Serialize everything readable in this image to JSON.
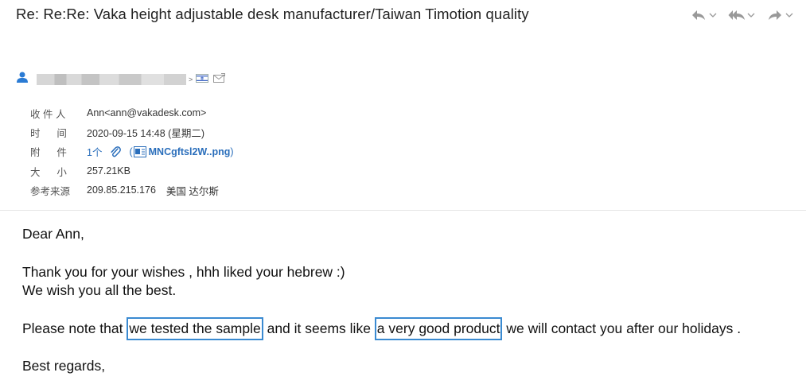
{
  "email": {
    "subject": "Re: Re:Re: Vaka height adjustable desk manufacturer/Taiwan Timotion quality",
    "sender_caret": ">",
    "meta": {
      "recipient_label": "收 件 人",
      "recipient_value": "Ann<ann@vakadesk.com>",
      "time_label": "时      间",
      "time_value": "2020-09-15 14:48 (星期二)",
      "attachment_label": "附      件",
      "attachment_count": "1个",
      "attachment_paren_open": "(",
      "attachment_name": "MNCgftsl2W..png",
      "attachment_paren_close": ")",
      "size_label": "大      小",
      "size_value": "257.21KB",
      "source_label": "参考来源",
      "source_ip": "209.85.215.176",
      "source_location": "美国 达尔斯"
    },
    "body": {
      "greeting": "Dear Ann,",
      "line1": "Thank you for your wishes , hhh liked your hebrew :)",
      "line2": "We wish you all the best.",
      "line3_a": "Please note that ",
      "line3_hl1": "we tested the sample",
      "line3_b": " and it seems like ",
      "line3_hl2": "a very good product",
      "line3_c": " we will contact you after our holidays .",
      "closing": "Best regards,"
    }
  },
  "colors": {
    "link": "#2a6ebb",
    "highlight_border": "#3a8ad1",
    "toolbar_icon": "#999999"
  },
  "icons": [
    "reply-icon",
    "reply-all-icon",
    "forward-icon",
    "chevron-down-icon",
    "user-icon",
    "flag-icon",
    "envelope-icon",
    "paperclip-icon",
    "file-icon"
  ]
}
